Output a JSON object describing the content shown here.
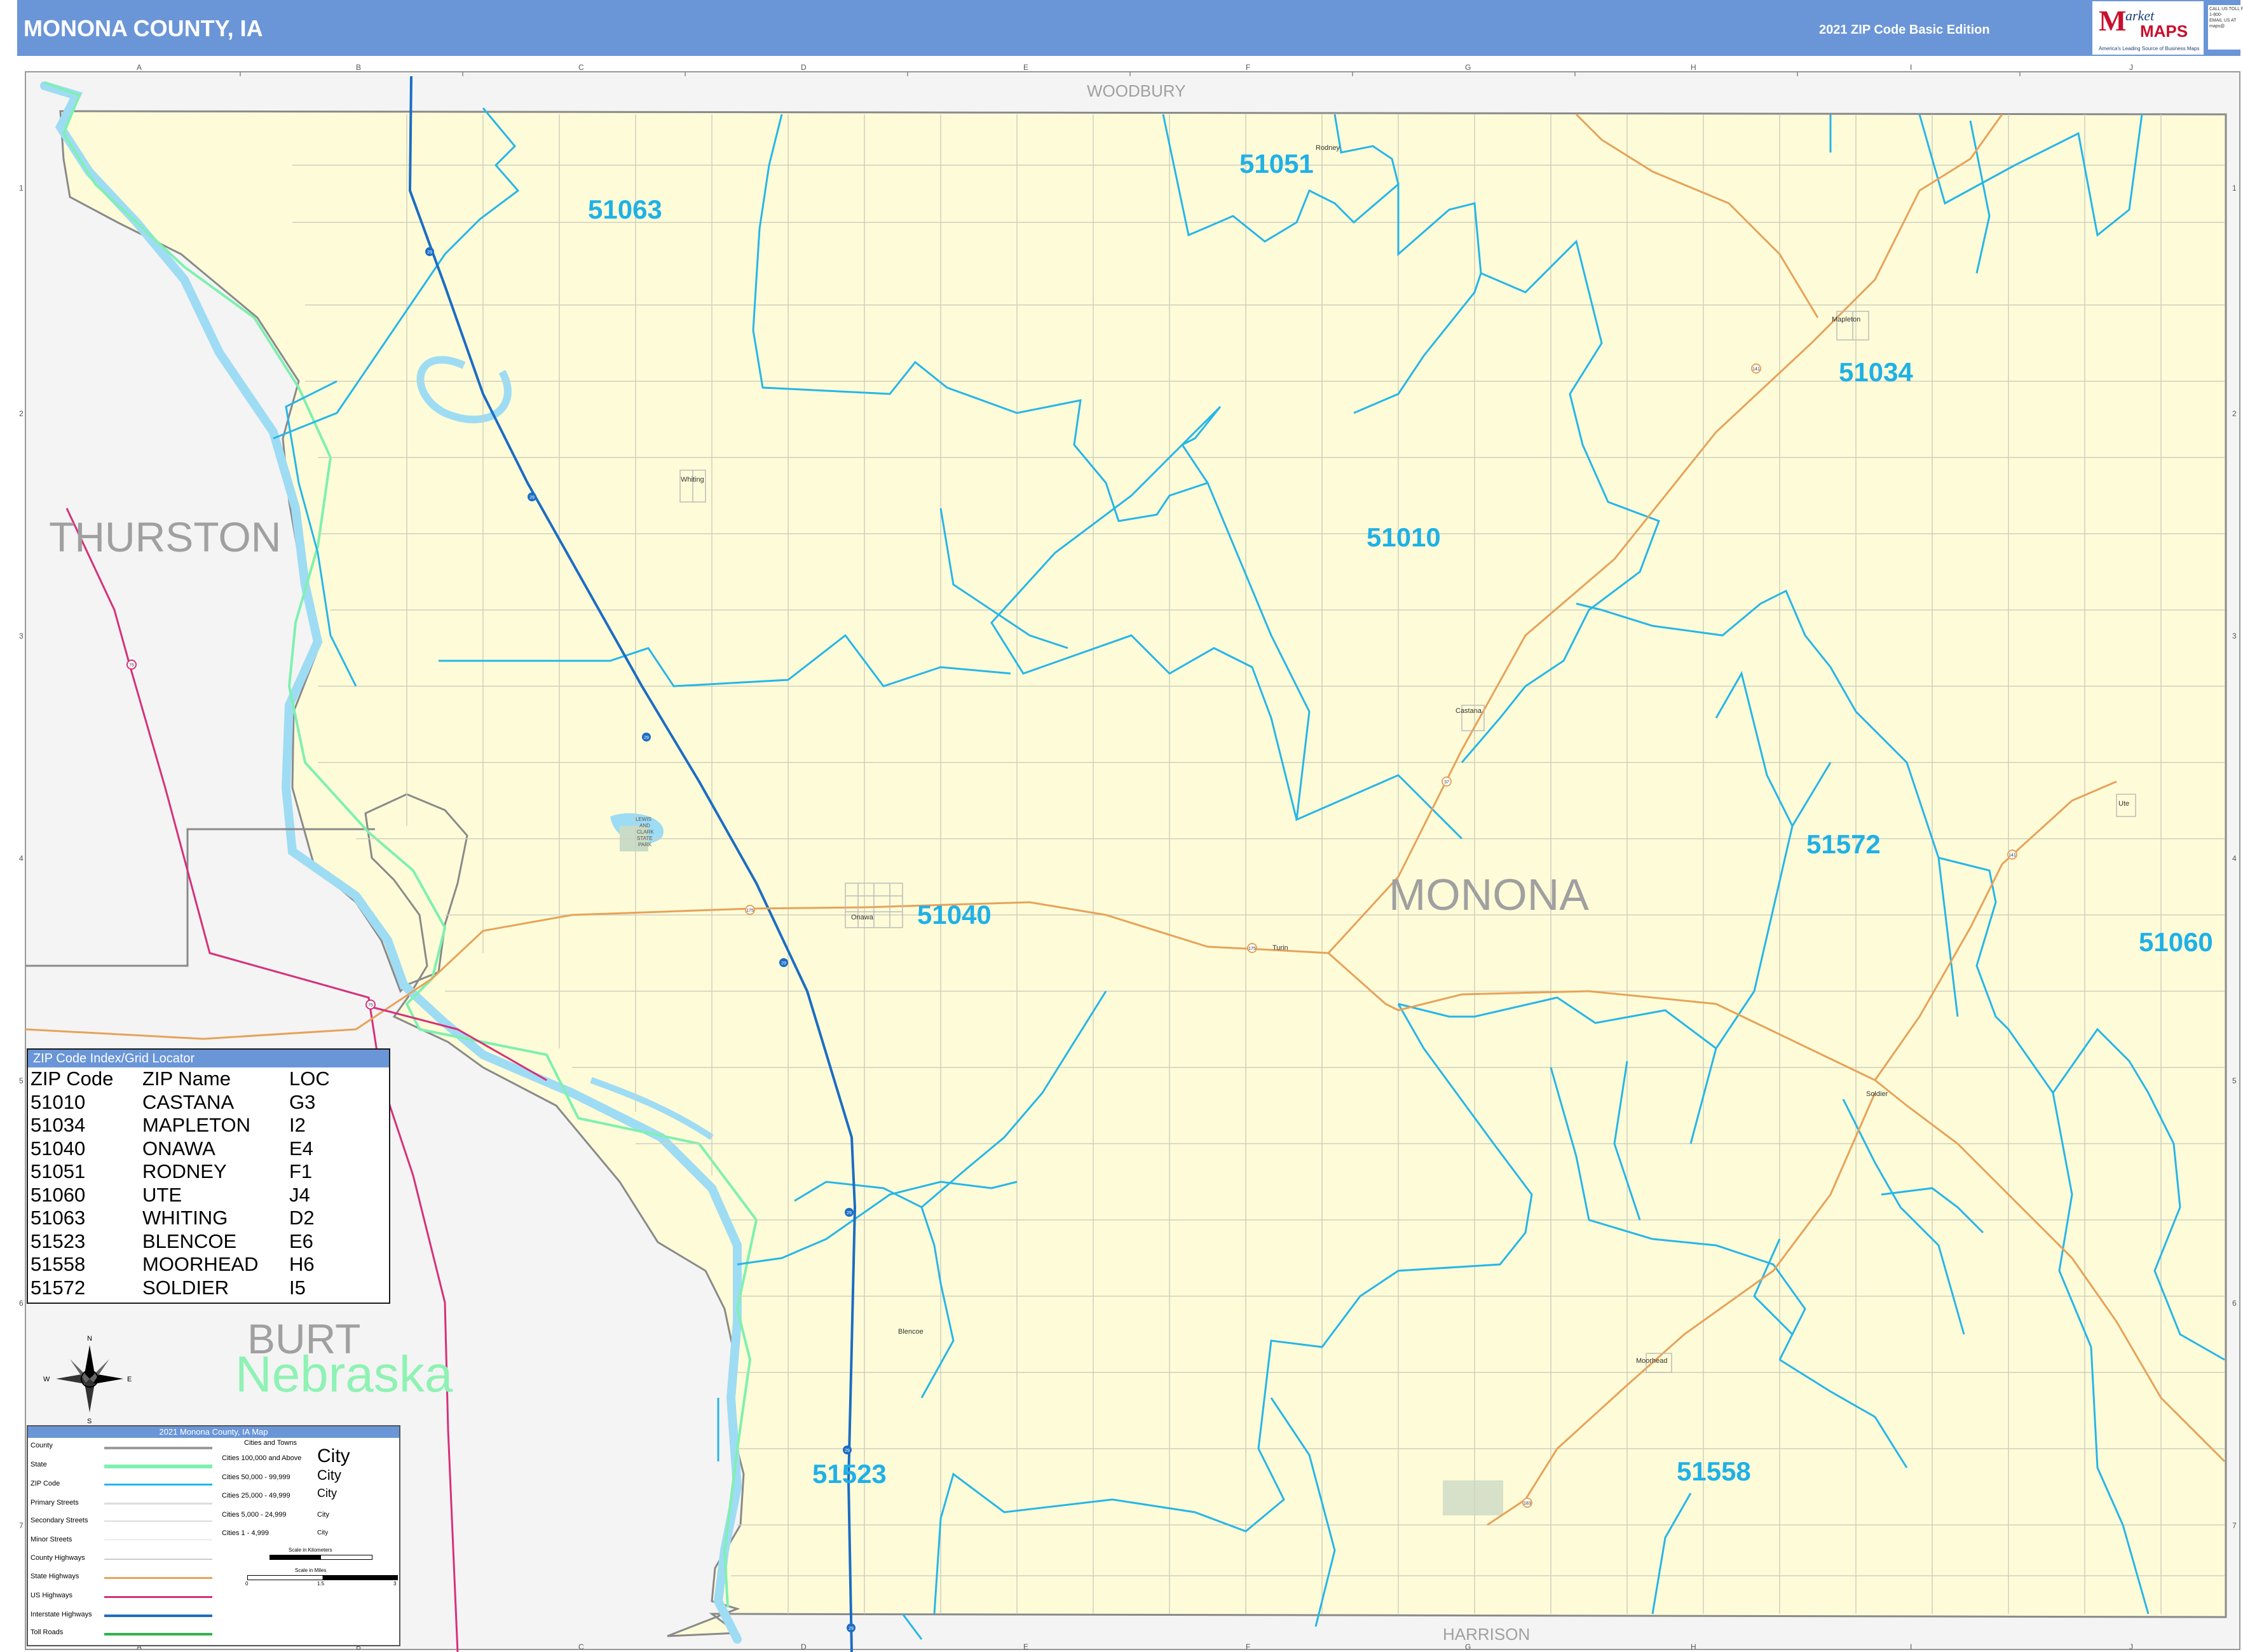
{
  "header": {
    "title": "MONONA COUNTY, IA",
    "edition": "2021 ZIP Code Basic Edition",
    "logo_mark": "M",
    "logo_word1": "arket",
    "logo_word2": "MAPS",
    "logo_tagline": "America's Leading Source of Business Maps",
    "contact": [
      "CALL US TOLL FREE",
      "1-800-",
      "EMAIL US AT",
      "maps@"
    ]
  },
  "colors": {
    "header_bg": "#6a96d8",
    "land": "#fefcd8",
    "outside_land": "#f4f4f4",
    "zip_boundary": "#26b6e8",
    "zip_label": "#1fb1e6",
    "river": "#9edcf4",
    "interstate": "#1c6dc4",
    "state_highway": "#e7a25a",
    "us_highway": "#d6307a",
    "state_line": "#7ff0b0",
    "county_line": "#8a8a8a"
  },
  "grid": {
    "columns": [
      "A",
      "B",
      "C",
      "D",
      "E",
      "F",
      "G",
      "H",
      "I",
      "J"
    ],
    "rows": [
      "1",
      "2",
      "3",
      "4",
      "5",
      "6",
      "7"
    ]
  },
  "map": {
    "neighbor_counties": {
      "woodbury": "WOODBURY",
      "harrison": "HARRISON",
      "thurston": "THURSTON",
      "burt": "BURT"
    },
    "county_name": "MONONA",
    "state_name": "Nebraska",
    "zip_labels": {
      "z51063": "51063",
      "z51051": "51051",
      "z51034": "51034",
      "z51010": "51010",
      "z51040": "51040",
      "z51572": "51572",
      "z51060": "51060",
      "z51523": "51523",
      "z51558": "51558"
    },
    "towns": {
      "rodney": "Rodney",
      "mapleton": "Mapleton",
      "whiting": "Whiting",
      "castana": "Castana",
      "onawa": "Onawa",
      "turin": "Turin",
      "ute": "Ute",
      "soldier": "Soldier",
      "blencoe": "Blencoe",
      "moorhead": "Moorhead"
    },
    "park_label": [
      "LEWIS",
      "AND",
      "CLARK",
      "STATE",
      "PARK"
    ],
    "highway_shields": {
      "i29": "29",
      "us75": "75",
      "ia175": "175",
      "ia37": "37",
      "ia141": "141",
      "ia183": "183"
    },
    "compass": {
      "n": "N",
      "s": "S",
      "e": "E",
      "w": "W"
    }
  },
  "zip_index": {
    "caption": "ZIP Code Index/Grid Locator",
    "headers": [
      "ZIP Code",
      "ZIP Name",
      "LOC"
    ],
    "rows": [
      [
        "51010",
        "CASTANA",
        "G3"
      ],
      [
        "51034",
        "MAPLETON",
        "I2"
      ],
      [
        "51040",
        "ONAWA",
        "E4"
      ],
      [
        "51051",
        "RODNEY",
        "F1"
      ],
      [
        "51060",
        "UTE",
        "J4"
      ],
      [
        "51063",
        "WHITING",
        "D2"
      ],
      [
        "51523",
        "BLENCOE",
        "E6"
      ],
      [
        "51558",
        "MOORHEAD",
        "H6"
      ],
      [
        "51572",
        "SOLDIER",
        "I5"
      ]
    ]
  },
  "legend": {
    "caption": "2021 Monona County, IA Map",
    "items": [
      "County",
      "State",
      "ZIP Code",
      "Primary Streets",
      "Secondary Streets",
      "Minor Streets",
      "County Highways",
      "State Highways",
      "US Highways",
      "Interstate Highways",
      "Toll Roads"
    ],
    "cities_title": "Cities and Towns",
    "city_classes": [
      "Cities 100,000 and Above",
      "Cities 50,000 - 99,999",
      "Cities 25,000 - 49,999",
      "Cities 5,000 - 24,999",
      "Cities 1 - 4,999"
    ],
    "city_sample": "City",
    "scale_km": "Scale in Kilometers",
    "scale_mi": "Scale in Miles",
    "scale_ticks": [
      "0",
      "1.5",
      "3"
    ]
  }
}
